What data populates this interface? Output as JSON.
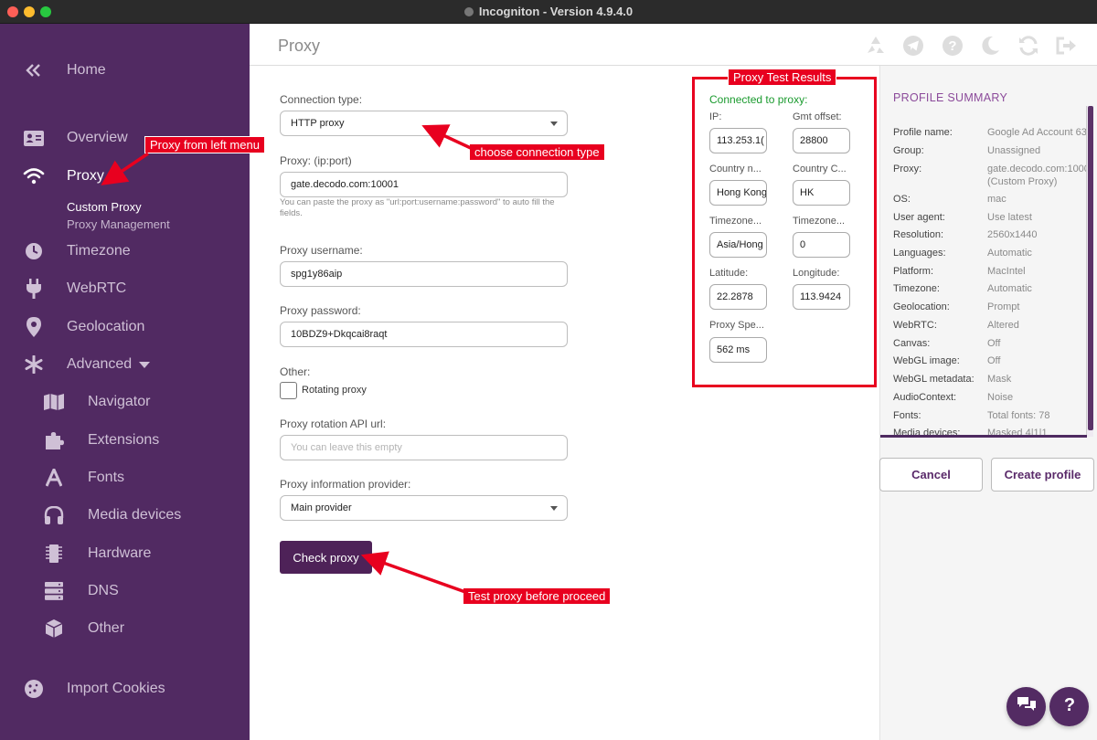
{
  "window": {
    "title": "Incogniton - Version 4.9.4.0"
  },
  "sidebar": {
    "home": "Home",
    "overview": "Overview",
    "proxy": "Proxy",
    "proxy_sub": [
      "Custom Proxy",
      "Proxy Management"
    ],
    "timezone": "Timezone",
    "webrtc": "WebRTC",
    "geolocation": "Geolocation",
    "advanced": "Advanced",
    "advanced_items": [
      "Navigator",
      "Extensions",
      "Fonts",
      "Media devices",
      "Hardware",
      "DNS",
      "Other"
    ],
    "import_cookies": "Import Cookies"
  },
  "header": {
    "title": "Proxy",
    "icons": [
      "recycle-icon",
      "telegram-icon",
      "help-icon",
      "moon-icon",
      "refresh-icon",
      "logout-icon"
    ]
  },
  "form": {
    "connection_type_label": "Connection type:",
    "connection_type_value": "HTTP proxy",
    "proxy_label": "Proxy: (ip:port)",
    "proxy_value": "gate.decodo.com:10001",
    "proxy_hint": "You can paste the proxy as \"url:port:username:password\" to auto fill the fields.",
    "username_label": "Proxy username:",
    "username_value": "spg1y86aip",
    "password_label": "Proxy password:",
    "password_value": "10BDZ9+Dkqcai8raqt",
    "other_label": "Other:",
    "rotating_label": "Rotating proxy",
    "rotation_url_label": "Proxy rotation API url:",
    "rotation_url_placeholder": "You can leave this empty",
    "provider_label": "Proxy information provider:",
    "provider_value": "Main provider",
    "check_button": "Check proxy"
  },
  "test_results": {
    "title": "Proxy Test Results",
    "status": "Connected to proxy:",
    "ip_label": "IP:",
    "ip_value": "113.253.1(",
    "gmt_label": "Gmt offset:",
    "gmt_value": "28800",
    "country_name_label": "Country n...",
    "country_name_value": "Hong Kong",
    "country_code_label": "Country C...",
    "country_code_value": "HK",
    "timezone_label": "Timezone...",
    "timezone_value": "Asia/Hong",
    "timezone2_label": "Timezone...",
    "timezone2_value": "0",
    "latitude_label": "Latitude:",
    "latitude_value": "22.2878",
    "longitude_label": "Longitude:",
    "longitude_value": "113.9424",
    "speed_label": "Proxy Spe...",
    "speed_value": "562 ms"
  },
  "annotations": {
    "left_menu": "Proxy from left menu",
    "connection_type": "choose connection type",
    "test_proxy": "Test proxy before proceed"
  },
  "summary": {
    "title": "PROFILE SUMMARY",
    "rows": [
      {
        "key": "Profile name:",
        "value": "Google Ad Account 63"
      },
      {
        "key": "Group:",
        "value": "Unassigned"
      },
      {
        "key": "Proxy:",
        "value": "gate.decodo.com:1000",
        "value2": "(Custom Proxy)"
      },
      {
        "key": "OS:",
        "value": "mac"
      },
      {
        "key": "User agent:",
        "value": "Use latest"
      },
      {
        "key": "Resolution:",
        "value": "2560x1440"
      },
      {
        "key": "Languages:",
        "value": "Automatic"
      },
      {
        "key": "Platform:",
        "value": "MacIntel"
      },
      {
        "key": "Timezone:",
        "value": "Automatic"
      },
      {
        "key": "Geolocation:",
        "value": "Prompt"
      },
      {
        "key": "WebRTC:",
        "value": "Altered"
      },
      {
        "key": "Canvas:",
        "value": "Off"
      },
      {
        "key": "WebGL image:",
        "value": "Off"
      },
      {
        "key": "WebGL metadata:",
        "value": "Mask"
      },
      {
        "key": "AudioContext:",
        "value": "Noise"
      },
      {
        "key": "Fonts:",
        "value": "Total fonts: 78"
      },
      {
        "key": "Media devices:",
        "value": "Masked 4|1|1"
      }
    ],
    "cancel": "Cancel",
    "create": "Create profile"
  },
  "colors": {
    "sidebar": "#512a62",
    "accent": "#4e2258",
    "annotation": "#e8001f",
    "connected": "#1a9a2e"
  }
}
